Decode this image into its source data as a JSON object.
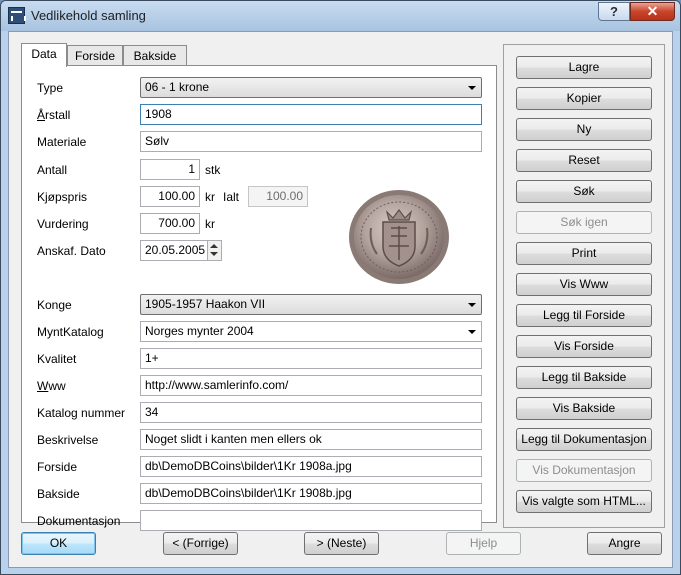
{
  "window": {
    "title": "Vedlikehold samling",
    "help_label": "?",
    "close_label": "✕"
  },
  "tabs": [
    {
      "label": "Data",
      "active": true
    },
    {
      "label": "Forside",
      "active": false
    },
    {
      "label": "Bakside",
      "active": false
    }
  ],
  "form": {
    "type": {
      "label": "Type",
      "value": "06 - 1 krone"
    },
    "year": {
      "label": "Årstall",
      "value": "1908"
    },
    "material": {
      "label": "Materiale",
      "value": "Sølv"
    },
    "count": {
      "label": "Antall",
      "value": "1",
      "unit": "stk"
    },
    "price": {
      "label": "Kjøpspris",
      "value": "100.00",
      "unit": "kr",
      "total_label": "Ialt",
      "total_value": "100.00"
    },
    "valuation": {
      "label": "Vurdering",
      "value": "700.00",
      "unit": "kr"
    },
    "acquired": {
      "label": "Anskaf. Dato",
      "value": "20.05.2005"
    },
    "king": {
      "label": "Konge",
      "value": "1905-1957 Haakon VII"
    },
    "catalog": {
      "label": "MyntKatalog",
      "value": "Norges mynter 2004"
    },
    "quality": {
      "label": "Kvalitet",
      "value": "1+"
    },
    "www": {
      "label": "Www",
      "value": "http://www.samlerinfo.com/"
    },
    "catalog_number": {
      "label": "Katalog nummer",
      "value": "34"
    },
    "description": {
      "label": "Beskrivelse",
      "value": "Noget slidt i kanten  men ellers ok"
    },
    "front": {
      "label": "Forside",
      "value": "db\\DemoDBCoins\\bilder\\1Kr 1908a.jpg"
    },
    "back": {
      "label": "Bakside",
      "value": "db\\DemoDBCoins\\bilder\\1Kr 1908b.jpg"
    },
    "documentation": {
      "label": "Dokumentasjon",
      "value": ""
    }
  },
  "side_buttons": [
    {
      "label": "Lagre",
      "enabled": true
    },
    {
      "label": "Kopier",
      "enabled": true
    },
    {
      "label": "Ny",
      "enabled": true
    },
    {
      "label": "Reset",
      "enabled": true
    },
    {
      "label": "Søk",
      "enabled": true
    },
    {
      "label": "Søk igen",
      "enabled": false
    },
    {
      "label": "Print",
      "enabled": true
    },
    {
      "label": "Vis Www",
      "enabled": true
    },
    {
      "label": "Legg til Forside",
      "enabled": true
    },
    {
      "label": "Vis Forside",
      "enabled": true
    },
    {
      "label": "Legg til Bakside",
      "enabled": true
    },
    {
      "label": "Vis Bakside",
      "enabled": true
    },
    {
      "label": "Legg til Dokumentasjon",
      "enabled": true
    },
    {
      "label": "Vis Dokumentasjon",
      "enabled": false
    },
    {
      "label": "Vis valgte som HTML...",
      "enabled": true
    }
  ],
  "bottom_buttons": {
    "ok": "OK",
    "previous": "< (Forrige)",
    "next": "> (Neste)",
    "help": "Hjelp",
    "cancel": "Angre"
  },
  "colors": {
    "title_bar": "#b9d1ea",
    "close_button": "#c8452b",
    "focus_border": "#3c7fb1"
  },
  "icons": {
    "app": "app-icon",
    "coin": "coin-image"
  }
}
